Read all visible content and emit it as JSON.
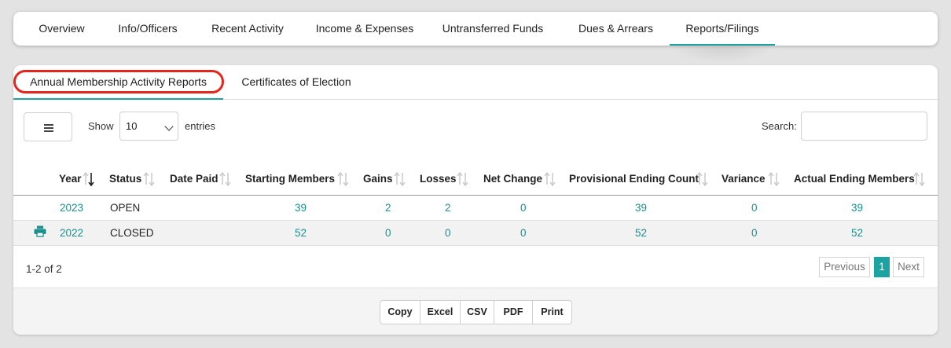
{
  "top_tabs": [
    {
      "label": "Overview"
    },
    {
      "label": "Info/Officers"
    },
    {
      "label": "Recent Activity"
    },
    {
      "label": "Income & Expenses"
    },
    {
      "label": "Untransferred Funds"
    },
    {
      "label": "Dues & Arrears"
    },
    {
      "label": "Reports/Filings",
      "active": true
    }
  ],
  "sub_tabs": [
    {
      "label": "Annual Membership Activity Reports",
      "active": true
    },
    {
      "label": "Certificates of Election"
    }
  ],
  "controls": {
    "columns_icon": "menu-icon",
    "show_label": "Show",
    "entries_value": "10",
    "entries_label": "entries",
    "search_label": "Search:",
    "search_value": ""
  },
  "table": {
    "headers": [
      "Year",
      "Status",
      "Date Paid",
      "Starting Members",
      "Gains",
      "Losses",
      "Net Change",
      "Provisional Ending Count",
      "Variance",
      "Actual Ending Members"
    ],
    "sorted_column": "Year",
    "sort_direction": "descending",
    "rows": [
      {
        "icon": "",
        "year": "2023",
        "status": "OPEN",
        "date_paid": "",
        "starting": "39",
        "gains": "2",
        "losses": "2",
        "net": "0",
        "provisional": "39",
        "variance": "0",
        "actual": "39"
      },
      {
        "icon": "print-icon",
        "year": "2022",
        "status": "CLOSED",
        "date_paid": "",
        "starting": "52",
        "gains": "0",
        "losses": "0",
        "net": "0",
        "provisional": "52",
        "variance": "0",
        "actual": "52"
      }
    ]
  },
  "pagination": {
    "summary": "1-2 of 2",
    "previous": "Previous",
    "current": "1",
    "next": "Next"
  },
  "export_buttons": [
    "Copy",
    "Excel",
    "CSV",
    "PDF",
    "Print"
  ],
  "colors": {
    "accent": "#1aa3a0",
    "highlight": "#e5241b",
    "link": "#1a8f8c"
  }
}
